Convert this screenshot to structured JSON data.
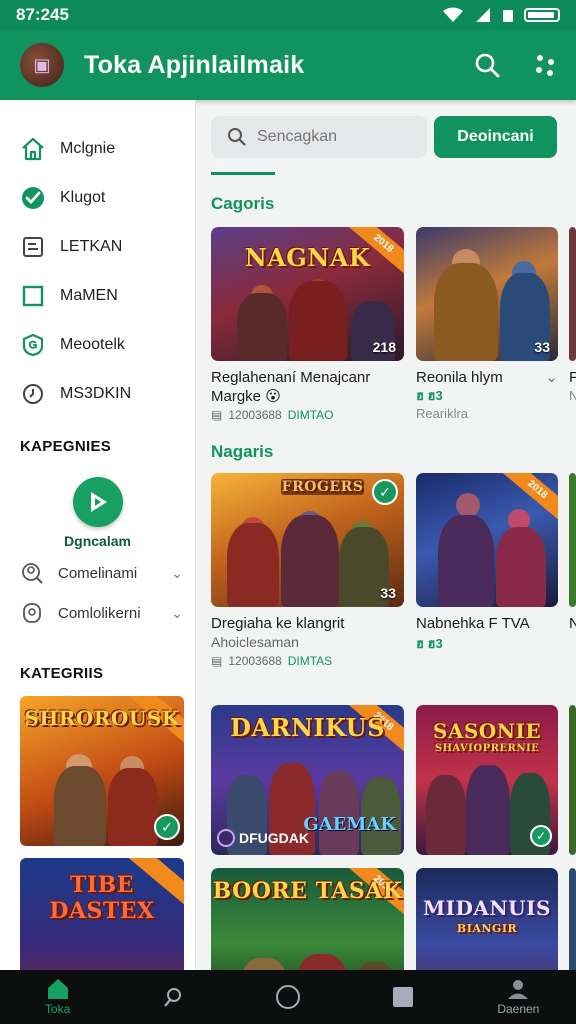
{
  "status_bar": {
    "time": "87:245"
  },
  "app_bar": {
    "title": "Toka Apjinlailmaik",
    "avatar_glyph": "▣"
  },
  "sidebar": {
    "items": [
      {
        "label": "Mclgnie",
        "icon": "home-icon"
      },
      {
        "label": "Klugot",
        "icon": "heart-badge-icon"
      },
      {
        "label": "LETKAN",
        "icon": "document-icon"
      },
      {
        "label": "MaMEN",
        "icon": "square-icon"
      },
      {
        "label": "Meootelk",
        "icon": "shield-icon"
      },
      {
        "label": "MS3DKIN",
        "icon": "clock-icon"
      }
    ],
    "section1_title": "KAPEGNIES",
    "play_label": "Dgncalam",
    "sub_items": [
      {
        "label": "Comelinami",
        "icon": "user-search-icon"
      },
      {
        "label": "Comlolikerni",
        "icon": "user-badge-icon"
      }
    ],
    "section2_title": "KATEGRIIS",
    "card_arts": [
      "SHROROUSK",
      "TIBE DASTEX"
    ]
  },
  "main": {
    "search_placeholder": "Sencagkan",
    "primary_button": "Deoincani",
    "row1_title": "Cagoris",
    "row2_title": "Nagaris",
    "row1": [
      {
        "art": "NAGNAK",
        "ribbon": "2018",
        "badge": "218",
        "title": "Reglahenaní Menajcanr Margke",
        "emoji": "😮",
        "meta_date": "12003688",
        "meta_tag": "DIMTAO"
      },
      {
        "art": "",
        "ribbon": "",
        "badge": "33",
        "title": "Reonila hlym",
        "price": "ฮ ฮ3",
        "price_sub": "Reariklra"
      },
      {
        "title": "F",
        "price_sub": "N"
      }
    ],
    "row2": [
      {
        "art": "FROGERS",
        "badge": "33",
        "title": "Dregiaha ke klangrit",
        "subtitle": "Ahoiclesaman",
        "meta_date": "12003688",
        "meta_tag": "DIMTAS"
      },
      {
        "art": "",
        "ribbon": "2018",
        "title": "Nabnehka F TVA",
        "price": "ฮ ฮ3"
      },
      {
        "title": "N"
      }
    ],
    "row3": [
      {
        "art": "DARNIKUS",
        "ribbon": "2018",
        "bottom_text": "DFUGDAK",
        "bottom_text2": "GAEMAK"
      },
      {
        "art": "SASONIE",
        "art_sub": "SHAVIOPRERNIE"
      },
      {}
    ],
    "row4": [
      {
        "art": "BOORE TASAK",
        "ribbon": "2018"
      },
      {
        "art": "MIDANUIS",
        "art_sub": "BIANGIR"
      },
      {}
    ]
  },
  "bottom_nav": {
    "items": [
      {
        "label": "Toka",
        "icon": "home-icon",
        "active": true
      },
      {
        "label": "",
        "icon": "search-icon"
      },
      {
        "label": "",
        "icon": "circle-icon"
      },
      {
        "label": "",
        "icon": "square-icon"
      },
      {
        "label": "Daenen",
        "icon": "profile-icon"
      }
    ]
  },
  "colors": {
    "brand": "#11935f",
    "accent": "#f08a1c"
  }
}
